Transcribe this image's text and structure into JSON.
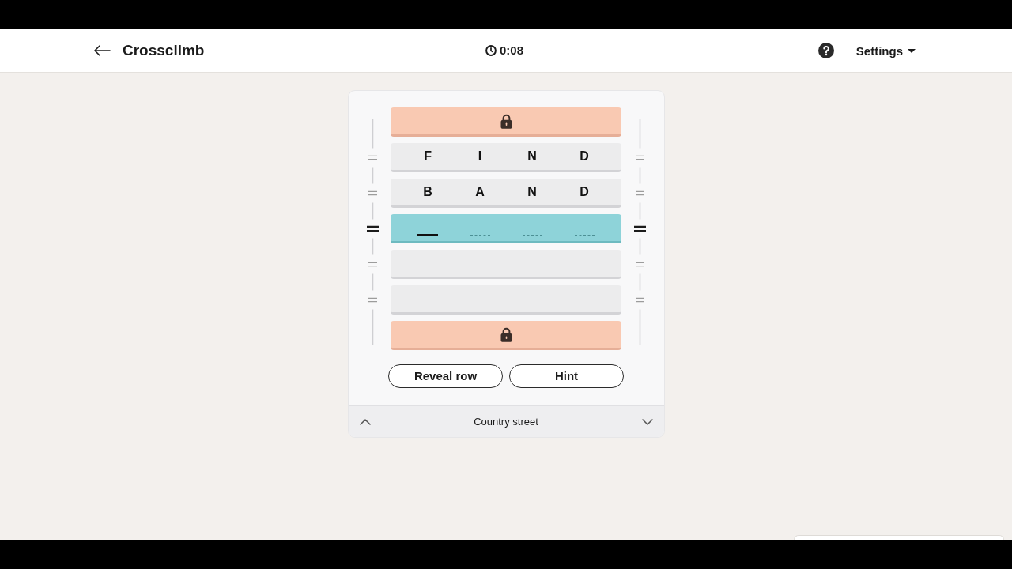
{
  "header": {
    "title": "Crossclimb",
    "timer": "0:08",
    "settings_label": "Settings"
  },
  "rows": [
    {
      "kind": "locked",
      "selected": false
    },
    {
      "kind": "word",
      "selected": false,
      "letters": [
        "F",
        "I",
        "N",
        "D"
      ]
    },
    {
      "kind": "word",
      "selected": false,
      "letters": [
        "B",
        "A",
        "N",
        "D"
      ]
    },
    {
      "kind": "input",
      "selected": true,
      "slots": [
        {
          "cursor": true
        },
        {
          "cursor": false
        },
        {
          "cursor": false
        },
        {
          "cursor": false
        }
      ]
    },
    {
      "kind": "empty",
      "selected": false
    },
    {
      "kind": "empty",
      "selected": false
    },
    {
      "kind": "locked",
      "selected": false
    }
  ],
  "buttons": [
    "Reveal row",
    "Hint"
  ],
  "clue": {
    "text": "Country street"
  }
}
